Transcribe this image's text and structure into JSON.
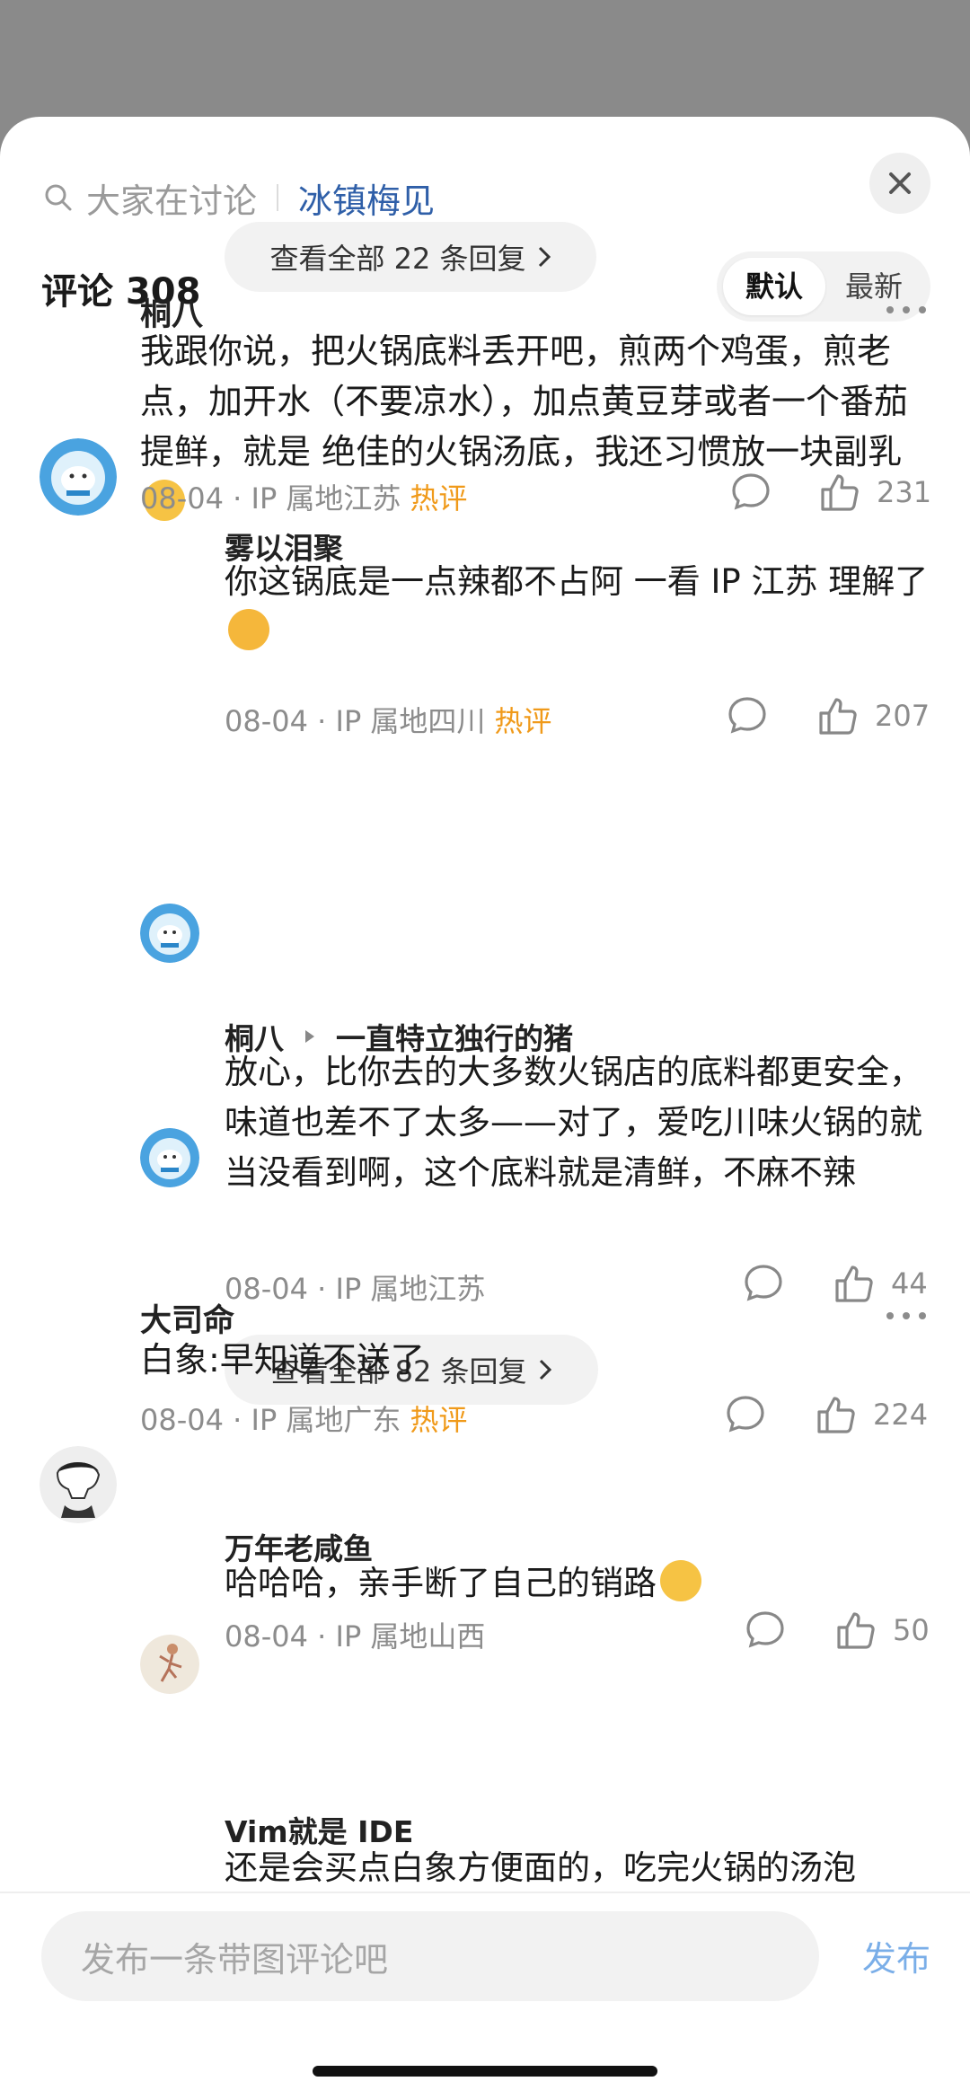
{
  "header": {
    "search_placeholder": "大家在讨论",
    "topic": "冰镇梅见"
  },
  "comments_header": {
    "title": "评论 308",
    "sort_options": [
      "默认",
      "最新"
    ]
  },
  "view_more_top": "查看全部 22 条回复",
  "comments": [
    {
      "author": "桐八",
      "text": "我跟你说，把火锅底料丢开吧，煎两个鸡蛋，煎老点，加开水（不要凉水），加点黄豆芽或者一个番茄提鲜，就是 绝佳的火锅汤底，我还习惯放一块副乳",
      "date": "08-04 · IP 属地江苏",
      "badge": "热评",
      "likes": "231",
      "replies": [
        {
          "author": "雾以泪聚",
          "text": "你这锅底是一点辣都不占阿 一看 IP 江苏 理解了",
          "date": "08-04 · IP 属地四川",
          "badge": "热评",
          "likes": "207"
        },
        {
          "author": "桐八",
          "reply_to": "一直特立独行的猪",
          "text": "放心，比你去的大多数火锅店的底料都更安全，味道也差不了太多——对了，爱吃川味火锅的就当没看到啊，这个底料就是清鲜，不麻不辣",
          "date": "08-04 · IP 属地江苏",
          "likes": "44"
        }
      ],
      "view_more": "查看全部 82 条回复"
    },
    {
      "author": "大司命",
      "text": "白象:早知道不送了",
      "date": "08-04 · IP 属地广东",
      "badge": "热评",
      "likes": "224",
      "replies": [
        {
          "author": "万年老咸鱼",
          "text": "哈哈哈，亲手断了自己的销路",
          "date": "08-04 · IP 属地山西",
          "likes": "50"
        },
        {
          "author": "Vim就是 IDE",
          "text": "还是会买点白象方便面的，吃完火锅的汤泡"
        }
      ]
    }
  ],
  "composer": {
    "placeholder": "发布一条带图评论吧",
    "submit": "发布"
  },
  "colors": {
    "topic": "#2f5fa8",
    "hot": "#f09a1a",
    "publish": "#7aaee8"
  }
}
